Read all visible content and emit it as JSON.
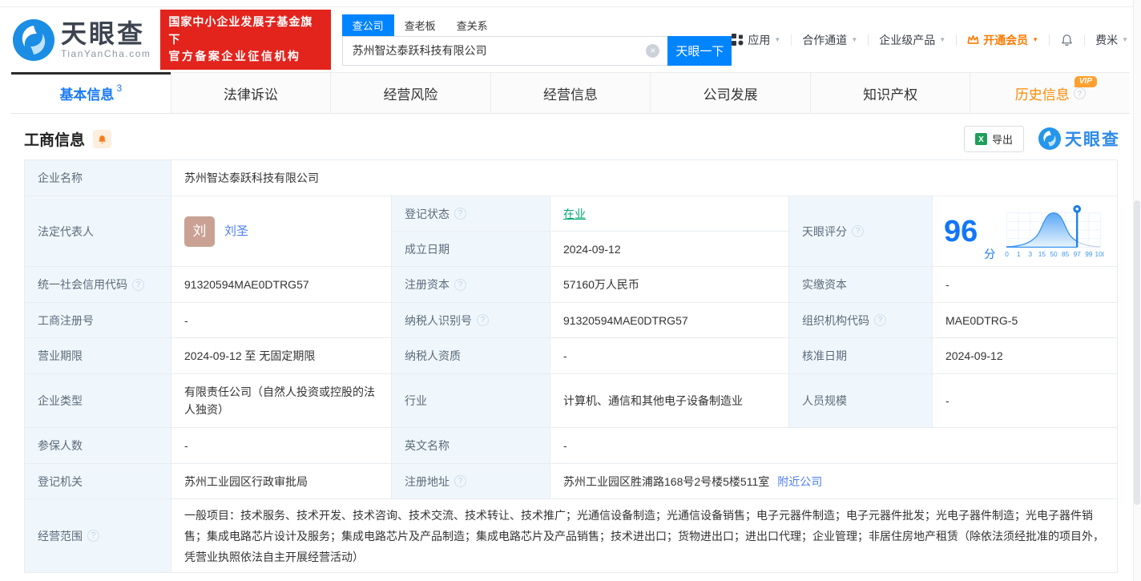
{
  "header": {
    "logo": {
      "brand": "天眼查",
      "domain": "TianYanCha.com"
    },
    "gov_badge": {
      "line1": "国家中小企业发展子基金旗下",
      "line2": "官方备案企业征信机构"
    },
    "search": {
      "tabs": [
        {
          "label": "查公司",
          "active": true
        },
        {
          "label": "查老板",
          "active": false
        },
        {
          "label": "查关系",
          "active": false
        }
      ],
      "value": "苏州智达泰跃科技有限公司",
      "button": "天眼一下"
    },
    "nav": {
      "apps": "应用",
      "partner": "合作通道",
      "enterprise": "企业级产品",
      "vip": "开通会员",
      "user": "费米"
    }
  },
  "tabs": [
    {
      "label": "基本信息",
      "count": "3",
      "active": true
    },
    {
      "label": "法律诉讼"
    },
    {
      "label": "经营风险"
    },
    {
      "label": "经营信息"
    },
    {
      "label": "公司发展"
    },
    {
      "label": "知识产权"
    },
    {
      "label": "历史信息",
      "vip": true
    }
  ],
  "section": {
    "title": "工商信息",
    "export_label": "导出",
    "watermark": "天眼查"
  },
  "biz": {
    "company_name": {
      "label": "企业名称",
      "value": "苏州智达泰跃科技有限公司"
    },
    "legal_rep": {
      "label": "法定代表人",
      "avatar": "刘",
      "name": "刘圣"
    },
    "reg_status": {
      "label": "登记状态",
      "value": "在业"
    },
    "establish_date": {
      "label": "成立日期",
      "value": "2024-09-12"
    },
    "score": {
      "label": "天眼评分",
      "value": "96",
      "unit": "分",
      "axis": [
        "0",
        "1",
        "3",
        "15",
        "50",
        "85",
        "97",
        "99",
        "100"
      ]
    },
    "credit_code": {
      "label": "统一社会信用代码",
      "value": "91320594MAE0DTRG57"
    },
    "reg_capital": {
      "label": "注册资本",
      "value": "57160万人民币"
    },
    "paid_capital": {
      "label": "实缴资本",
      "value": "-"
    },
    "reg_number": {
      "label": "工商注册号",
      "value": "-"
    },
    "taxpayer_id": {
      "label": "纳税人识别号",
      "value": "91320594MAE0DTRG57"
    },
    "org_code": {
      "label": "组织机构代码",
      "value": "MAE0DTRG-5"
    },
    "business_term": {
      "label": "营业期限",
      "value": "2024-09-12 至 无固定期限"
    },
    "taxpayer_quality": {
      "label": "纳税人资质",
      "value": "-"
    },
    "approval_date": {
      "label": "核准日期",
      "value": "2024-09-12"
    },
    "company_type": {
      "label": "企业类型",
      "value": "有限责任公司（自然人投资或控股的法人独资）"
    },
    "industry": {
      "label": "行业",
      "value": "计算机、通信和其他电子设备制造业"
    },
    "staff_size": {
      "label": "人员规模",
      "value": "-"
    },
    "insured_count": {
      "label": "参保人数",
      "value": "-"
    },
    "english_name": {
      "label": "英文名称",
      "value": "-"
    },
    "reg_authority": {
      "label": "登记机关",
      "value": "苏州工业园区行政审批局"
    },
    "reg_address": {
      "label": "注册地址",
      "value": "苏州工业园区胜浦路168号2号楼5楼511室",
      "link": "附近公司"
    },
    "business_scope": {
      "label": "经营范围",
      "value": "一般项目：技术服务、技术开发、技术咨询、技术交流、技术转让、技术推广；光通信设备制造；光通信设备销售；电子元器件制造；电子元器件批发；光电子器件制造；光电子器件销售；集成电路芯片设计及服务；集成电路芯片及产品制造；集成电路芯片及产品销售；技术进出口；货物进出口；进出口代理；企业管理；非居住房地产租赁（除依法须经批准的项目外，凭营业执照依法自主开展经营活动）"
    }
  },
  "icons": {
    "help_glyph": "?",
    "clear_glyph": "×",
    "caret_glyph": "▼",
    "vip_label": "VIP",
    "excel_glyph": "X"
  },
  "colors": {
    "accent": "#0084ff",
    "link": "#4c7ef3",
    "green": "#00a870",
    "badge_red": "#e2241d",
    "vip_orange": "#ff8a00",
    "label_bg": "#f0f7fc"
  }
}
